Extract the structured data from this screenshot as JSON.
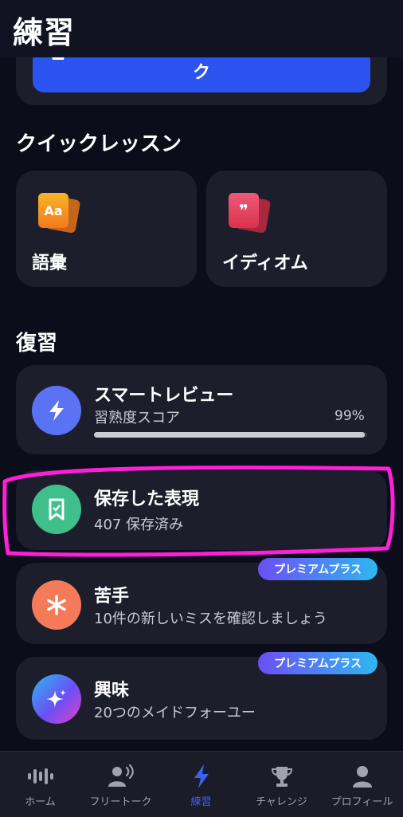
{
  "header": {
    "title": "練習"
  },
  "top_card": {
    "button_label": "ク"
  },
  "quick_lessons": {
    "title": "クイックレッスン",
    "items": [
      {
        "label": "語彙",
        "icon": "vocabulary-cards-icon",
        "icon_text": "Aa"
      },
      {
        "label": "イディオム",
        "icon": "idiom-cards-icon",
        "icon_text": "❞"
      }
    ]
  },
  "review": {
    "title": "復習",
    "smart_review": {
      "title": "スマートレビュー",
      "subtitle": "習熟度スコア",
      "percent_label": "99%",
      "progress": 0.99,
      "icon": "lightning-icon",
      "color": "#5a73f5"
    },
    "saved": {
      "title": "保存した表現",
      "subtitle": "407 保存済み",
      "icon": "bookmark-icon",
      "color": "#3fbf8c"
    },
    "weak": {
      "title": "苦手",
      "subtitle": "10件の新しいミスを確認しましょう",
      "badge": "プレミアムプラス",
      "icon": "asterisk-icon",
      "color": "#f47a5a"
    },
    "interest": {
      "title": "興味",
      "subtitle": "20つのメイドフォーユー",
      "badge": "プレミアムプラス",
      "icon": "sparkle-icon"
    }
  },
  "highlight_color": "#ff1fd6",
  "nav": {
    "items": [
      {
        "label": "ホーム",
        "icon": "waveform-icon",
        "active": false
      },
      {
        "label": "フリートーク",
        "icon": "speaking-person-icon",
        "active": false
      },
      {
        "label": "練習",
        "icon": "lightning-icon",
        "active": true
      },
      {
        "label": "チャレンジ",
        "icon": "trophy-icon",
        "active": false
      },
      {
        "label": "プロフィール",
        "icon": "person-icon",
        "active": false
      }
    ]
  }
}
